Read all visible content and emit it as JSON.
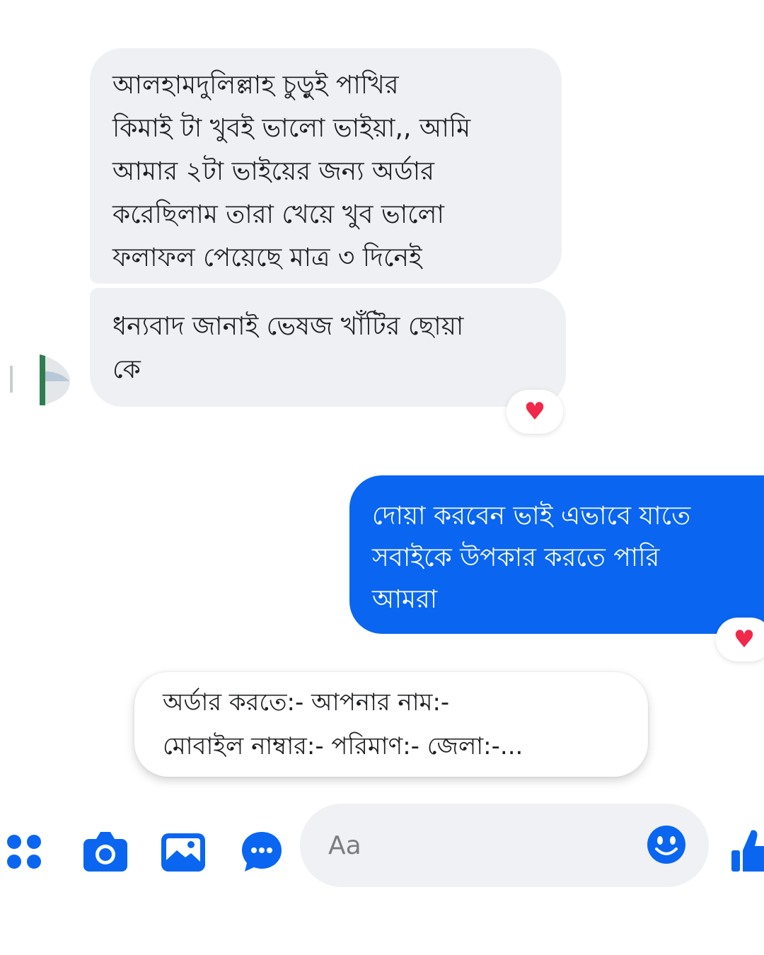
{
  "messages": [
    {
      "text": "আলহামদুলিল্লাহ চুড়ুই পাখির\nকিমাই টা খুবই ভালো ভাইয়া,, আমি\nআমার ২টা ভাইয়ের জন্য অর্ডার\nকরেছিলাম তারা খেয়ে খুব ভালো\nফলাফল পেয়েছে মাত্র ৩ দিনেই"
    },
    {
      "text": "ধন্যবাদ জানাই ভেষজ খাঁটির ছোয়া\nকে",
      "reaction": "♥"
    },
    {
      "text": "দোয়া করবেন ভাই এভাবে যাতে\nসবাইকে উপকার করতে পারি\nআমরা",
      "reaction": "♥"
    },
    {
      "text": "অর্ডার করতে:- আপনার নাম:-\nমোবাইল নাম্বার:- পরিমাণ:- জেলা:-..."
    }
  ],
  "composer": {
    "placeholder": "Aa"
  },
  "colors": {
    "accent": "#0a66f0",
    "incoming_bubble": "#eff0f3",
    "reaction": "#f02849"
  },
  "toolbar_icons": [
    "apps-icon",
    "camera-icon",
    "gallery-icon",
    "chat-icon",
    "emoji-icon",
    "like-icon"
  ]
}
